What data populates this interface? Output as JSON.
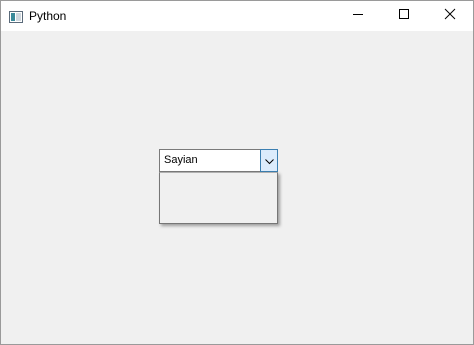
{
  "window": {
    "title": "Python",
    "icons": {
      "app": "window-app-icon",
      "minimize": "minimize-icon",
      "maximize": "maximize-icon",
      "close": "close-icon"
    }
  },
  "combobox": {
    "selected_value": "Sayian",
    "expanded": true,
    "arrow_icon": "chevron-down-icon",
    "accent_color": "#3c7fb1",
    "arrow_bg_color": "#dcecfc"
  }
}
